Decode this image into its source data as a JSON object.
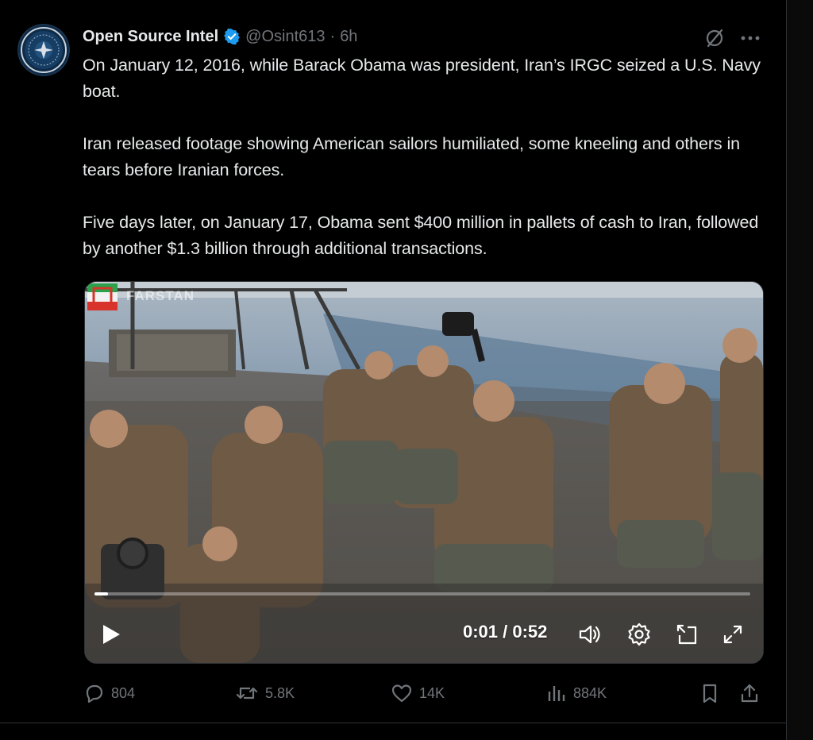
{
  "tweet": {
    "author_name": "Open Source Intel",
    "handle": "@Osint613",
    "separator": "·",
    "time": "6h",
    "paragraphs": [
      "On January 12, 2016, while Barack Obama was president, Iran’s IRGC seized a U.S. Navy boat.",
      "Iran released footage showing American sailors humiliated, some kneeling and others in tears before Iranian forces.",
      "Five days later, on January 17, Obama sent $400 million in pallets of cash to Iran, followed by another $1.3 billion through additional transactions."
    ]
  },
  "video": {
    "watermark_text": "FARSTAN",
    "current_time": "0:01 / 0:52",
    "progress": 0.02
  },
  "actions": {
    "replies": "804",
    "reposts": "5.8K",
    "likes": "14K",
    "views": "884K"
  },
  "colors": {
    "background": "#000000",
    "text": "#e7e9ea",
    "muted": "#71767b",
    "verified": "#1d9bf0",
    "border": "#2f3336"
  },
  "icons": {
    "verified": "verified-badge-icon",
    "grok": "grok-icon",
    "more": "more-icon",
    "play": "play-icon",
    "volume": "volume-icon",
    "settings": "gear-icon",
    "pip": "picture-in-picture-icon",
    "fullscreen": "fullscreen-icon",
    "reply": "reply-icon",
    "repost": "repost-icon",
    "like": "heart-icon",
    "views": "views-icon",
    "bookmark": "bookmark-icon",
    "share": "share-icon"
  }
}
